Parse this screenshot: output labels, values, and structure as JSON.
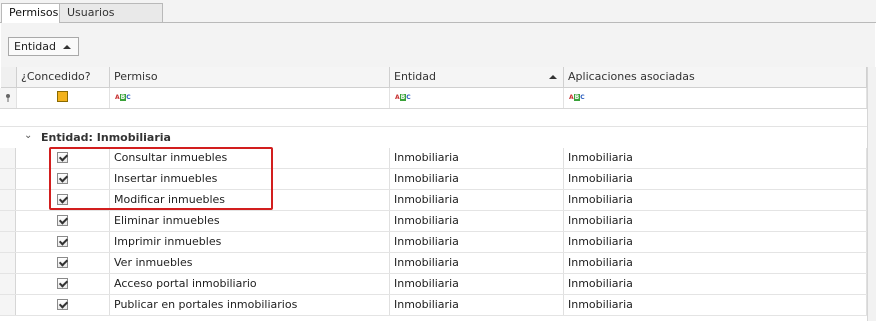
{
  "tabs": [
    {
      "label": "Permisos",
      "active": true
    },
    {
      "label": "Usuarios adscritos",
      "active": false
    }
  ],
  "group_panel": {
    "chip_label": "Entidad"
  },
  "columns": {
    "concedido": "¿Concedido?",
    "permiso": "Permiso",
    "entidad": "Entidad",
    "aplicaciones": "Aplicaciones  asociadas"
  },
  "filter_icons": {
    "abc_a": "A",
    "abc_b": "B",
    "abc_c": "C"
  },
  "group": {
    "label": "Entidad: Inmobiliaria"
  },
  "rows": [
    {
      "checked": true,
      "permiso": "Consultar inmuebles",
      "entidad": "Inmobiliaria",
      "aplicaciones": "Inmobiliaria"
    },
    {
      "checked": true,
      "permiso": "Insertar inmuebles",
      "entidad": "Inmobiliaria",
      "aplicaciones": "Inmobiliaria"
    },
    {
      "checked": true,
      "permiso": "Modificar inmuebles",
      "entidad": "Inmobiliaria",
      "aplicaciones": "Inmobiliaria"
    },
    {
      "checked": true,
      "permiso": "Eliminar inmuebles",
      "entidad": "Inmobiliaria",
      "aplicaciones": "Inmobiliaria"
    },
    {
      "checked": true,
      "permiso": "Imprimir inmuebles",
      "entidad": "Inmobiliaria",
      "aplicaciones": "Inmobiliaria"
    },
    {
      "checked": true,
      "permiso": "Ver inmuebles",
      "entidad": "Inmobiliaria",
      "aplicaciones": "Inmobiliaria"
    },
    {
      "checked": true,
      "permiso": "Acceso portal inmobiliario",
      "entidad": "Inmobiliaria",
      "aplicaciones": "Inmobiliaria"
    },
    {
      "checked": true,
      "permiso": "Publicar en portales inmobiliarios",
      "entidad": "Inmobiliaria",
      "aplicaciones": "Inmobiliaria"
    }
  ],
  "colors": {
    "highlight": "#d21e1e",
    "filter_checkbox": "#f2b21c"
  }
}
